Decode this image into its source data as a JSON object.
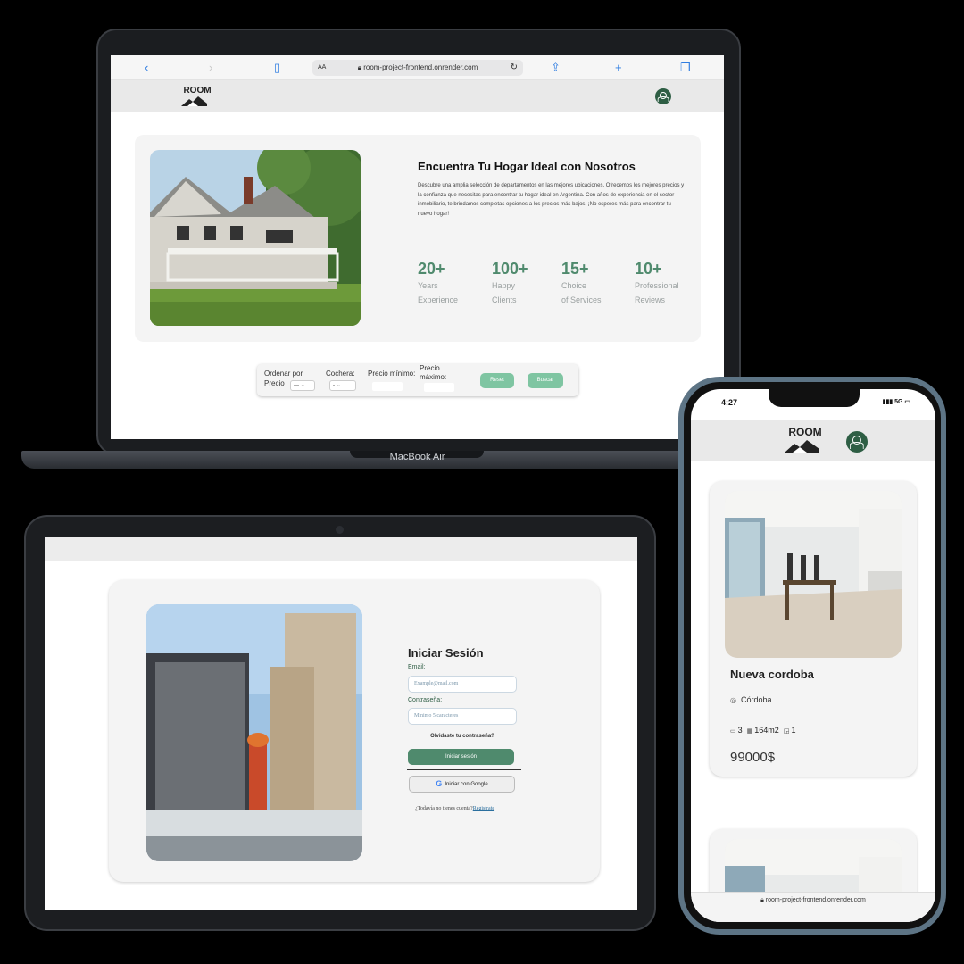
{
  "laptop": {
    "label": "MacBook Air",
    "browser": {
      "url": "room-project-frontend.onrender.com",
      "text_size": "AA",
      "back": "‹",
      "forward": "›",
      "reload": "↻",
      "share": "⇪",
      "new_tab": "+",
      "tabs": "❐",
      "reader": "▯"
    },
    "nav": {
      "logo": "ROOM"
    },
    "hero": {
      "title": "Encuentra Tu Hogar Ideal con Nosotros",
      "description": "Descubre una amplia selección de departamentos en las mejores ubicaciones. Ofrecemos los mejores precios y la confianza que necesitas para encontrar tu hogar ideal en Argentina. Con años de experiencia en el sector inmobiliario, te brindamos completas opciones a los precios más bajos. ¡No esperes más para encontrar tu nuevo hogar!",
      "stats": [
        {
          "value": "20+",
          "label_1": "Years",
          "label_2": "Experience"
        },
        {
          "value": "100+",
          "label_1": "Happy",
          "label_2": "Clients"
        },
        {
          "value": "15+",
          "label_1": "Choice",
          "label_2": "of Services"
        },
        {
          "value": "10+",
          "label_1": "Professional",
          "label_2": "Reviews"
        }
      ]
    },
    "filters": {
      "order_label_1": "Ordenar por",
      "order_label_2": "Precio",
      "order_value": "---",
      "garage_label": "Cochera:",
      "garage_value": "-",
      "min_price_label": "Precio mínimo:",
      "max_price_label_1": "Precio",
      "max_price_label_2": "máximo:",
      "reset": "Reset",
      "search": "Buscar"
    }
  },
  "tablet": {
    "login": {
      "title": "Iniciar Sesión",
      "email_label": "Email:",
      "email_placeholder": "Example@mail.com",
      "password_label": "Contraseña:",
      "password_placeholder": "Mínimo 5 caracteres",
      "forgot": "Olvidaste tu contraseña?",
      "submit": "Iniciar sesión",
      "google_icon": "G",
      "google": "Iniciar con Google",
      "register_prompt": "¿Todavía no tienes cuenta?",
      "register_link": "Registrate"
    }
  },
  "phone": {
    "time": "4:27",
    "status": "▮▮▮ 5G ▭",
    "nav": {
      "logo": "ROOM"
    },
    "property": {
      "title": "Nueva cordoba",
      "location": "Córdoba",
      "rooms": "3",
      "area": "164m2",
      "baths": "1",
      "price": "99000$"
    },
    "url": "room-project-frontend.onrender.com"
  },
  "colors": {
    "accent": "#4f8a6d",
    "accent_light": "#7fc5a2",
    "avatar": "#2e5e44"
  }
}
